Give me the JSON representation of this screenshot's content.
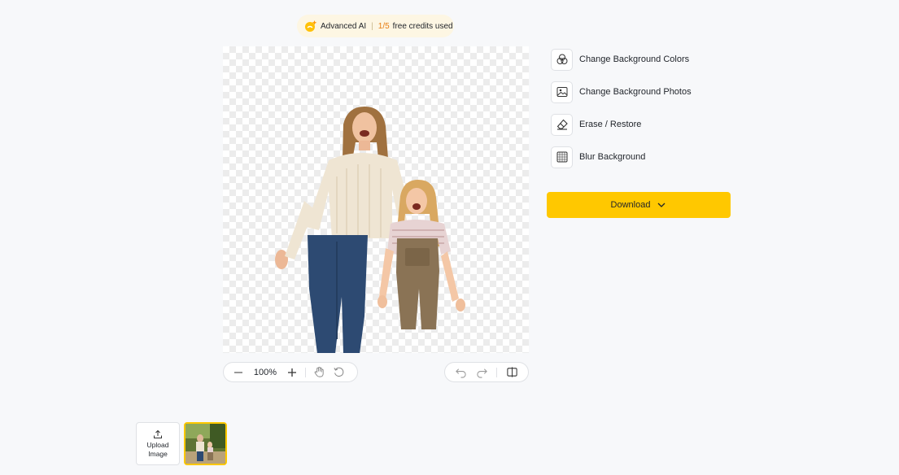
{
  "credits": {
    "label": "Advanced AI",
    "used_count": "1/5",
    "used_text": "free credits used",
    "icon": "ai-sparkle-icon"
  },
  "zoom": {
    "value": "100%"
  },
  "tools": [
    {
      "label": "Change Background Colors",
      "icon": "palette-circles-icon"
    },
    {
      "label": "Change Background Photos",
      "icon": "image-icon"
    },
    {
      "label": "Erase / Restore",
      "icon": "eraser-icon"
    },
    {
      "label": "Blur Background",
      "icon": "blur-grid-icon"
    }
  ],
  "download": {
    "label": "Download"
  },
  "upload": {
    "label_line1": "Upload",
    "label_line2": "Image"
  },
  "colors": {
    "accent": "#ffc800",
    "background": "#f7f8fa",
    "credits_highlight": "#e77d13"
  }
}
